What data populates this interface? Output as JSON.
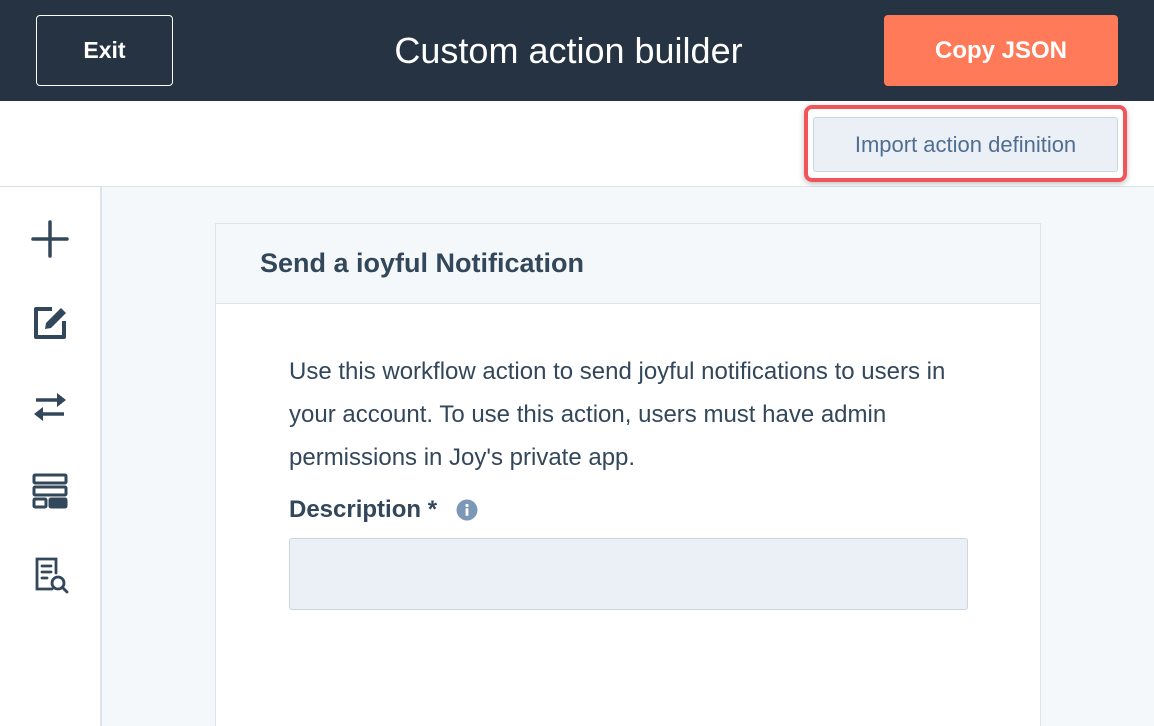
{
  "header": {
    "exit_label": "Exit",
    "title": "Custom action builder",
    "copy_label": "Copy JSON"
  },
  "toolbar": {
    "import_label": "Import action definition"
  },
  "sidebar": {
    "icons": [
      "plus-icon",
      "edit-icon",
      "swap-arrows-icon",
      "layout-icon",
      "search-document-icon"
    ]
  },
  "card": {
    "title": "Send a ioyful Notification",
    "description": "Use this workflow action to send joyful notifications to users in your account. To use this action, users must have admin permissions in Joy's private app.",
    "field_label": "Description *",
    "field_value": ""
  },
  "colors": {
    "header_bg": "#253342",
    "accent": "#ff7a59",
    "highlight": "#f2545b",
    "text": "#33475b"
  }
}
